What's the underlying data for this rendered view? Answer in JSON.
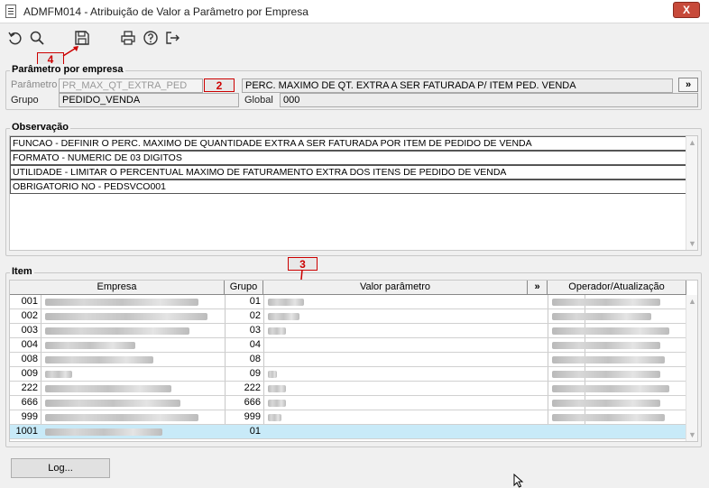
{
  "window": {
    "title": "ADMFM014 - Atribuição de Valor a Parâmetro por Empresa",
    "close_label": "X"
  },
  "toolbar": {
    "icons": [
      "undo-icon",
      "search-icon",
      "save-icon",
      "print-icon",
      "help-icon",
      "exit-icon"
    ]
  },
  "annotations": {
    "callout_4": "4",
    "callout_2": "2",
    "callout_3": "3",
    "color": "#cc0000"
  },
  "parametro_por_empresa": {
    "legend": "Parâmetro por empresa",
    "parametro_label": "Parâmetro",
    "parametro_value": "PR_MAX_QT_EXTRA_PED",
    "descricao_value": "PERC. MAXIMO DE QT. EXTRA A SER FATURADA P/ ITEM PED. VENDA",
    "expand_label": "»",
    "grupo_label": "Grupo",
    "grupo_value": "PEDIDO_VENDA",
    "global_label": "Global",
    "global_value": "000"
  },
  "observacao": {
    "legend": "Observação",
    "lines": [
      "FUNCAO - DEFINIR O PERC. MAXIMO DE QUANTIDADE EXTRA A SER FATURADA POR ITEM DE PEDIDO DE VENDA",
      "FORMATO - NUMERIC DE 03 DIGITOS",
      "UTILIDADE - LIMITAR O PERCENTUAL MAXIMO DE FATURAMENTO EXTRA DOS ITENS DE PEDIDO DE VENDA",
      "OBRIGATORIO NO - PEDSVCO001"
    ]
  },
  "item": {
    "legend": "Item",
    "columns": {
      "empresa": "Empresa",
      "grupo": "Grupo",
      "valor": "Valor parâmetro",
      "expand": "»",
      "operador": "Operador/Atualização"
    },
    "rows": [
      {
        "empresa": "001",
        "grupo": "01"
      },
      {
        "empresa": "002",
        "grupo": "02"
      },
      {
        "empresa": "003",
        "grupo": "03"
      },
      {
        "empresa": "004",
        "grupo": "04"
      },
      {
        "empresa": "008",
        "grupo": "08"
      },
      {
        "empresa": "009",
        "grupo": "09"
      },
      {
        "empresa": "222",
        "grupo": "222"
      },
      {
        "empresa": "666",
        "grupo": "666"
      },
      {
        "empresa": "999",
        "grupo": "999"
      },
      {
        "empresa": "1001",
        "grupo": "01"
      }
    ]
  },
  "log_button": "Log..."
}
